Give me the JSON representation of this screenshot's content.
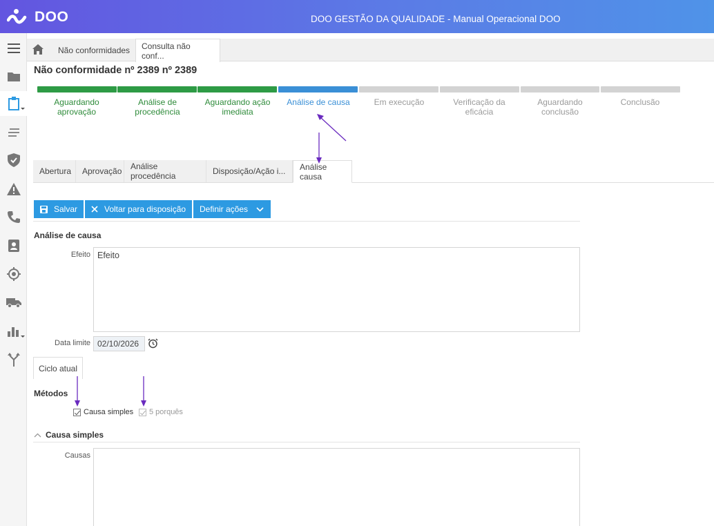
{
  "header": {
    "logo_text": "DOO",
    "app_title": "DOO GESTÃO DA QUALIDADE - Manual Operacional DOO"
  },
  "rail": {
    "items": [
      {
        "icon": "menu-icon"
      },
      {
        "icon": "folder-icon"
      },
      {
        "icon": "clipboard-icon"
      },
      {
        "icon": "list-icon"
      },
      {
        "icon": "shield-check-icon"
      },
      {
        "icon": "warning-icon"
      },
      {
        "icon": "phone-icon"
      },
      {
        "icon": "contact-card-icon"
      },
      {
        "icon": "target-icon"
      },
      {
        "icon": "truck-icon"
      },
      {
        "icon": "bar-chart-icon"
      },
      {
        "icon": "branch-icon"
      }
    ]
  },
  "tabs": {
    "items": [
      "Não conformidades",
      "Consulta não conf..."
    ]
  },
  "page": {
    "title": "Não conformidade nº 2389 nº 2389"
  },
  "workflow": {
    "steps": [
      {
        "label": "Aguardando aprovação",
        "status": "done"
      },
      {
        "label": "Análise de procedência",
        "status": "done"
      },
      {
        "label": "Aguardando ação imediata",
        "status": "done"
      },
      {
        "label": "Análise de causa",
        "status": "current"
      },
      {
        "label": "Em execução",
        "status": "pending"
      },
      {
        "label": "Verificação da eficácia",
        "status": "pending"
      },
      {
        "label": "Aguardando conclusão",
        "status": "pending"
      },
      {
        "label": "Conclusão",
        "status": "pending"
      }
    ],
    "colors": {
      "done": "#2e9b45",
      "current": "#3a8fd6",
      "pending": "#d3d3d3"
    }
  },
  "section_tabs": {
    "items": [
      "Abertura",
      "Aprovação",
      "Análise procedência",
      "Disposição/Ação i...",
      "Análise causa"
    ]
  },
  "toolbar": {
    "save": "Salvar",
    "back": "Voltar para disposição",
    "define": "Definir ações"
  },
  "analysis": {
    "heading": "Análise de causa",
    "effect_label": "Efeito",
    "effect_value": "Efeito",
    "deadline_label": "Data limite",
    "deadline_value": "02/10/2026",
    "cycle_tab": "Ciclo atual",
    "methods_label": "Métodos",
    "method_simple": "Causa simples",
    "method_whys": "5 porquês",
    "simple_heading": "Causa simples",
    "causes_label": "Causas",
    "causes_value": ""
  },
  "colors": {
    "accent": "#2d9ae2",
    "annotation": "#6a2bbf"
  }
}
